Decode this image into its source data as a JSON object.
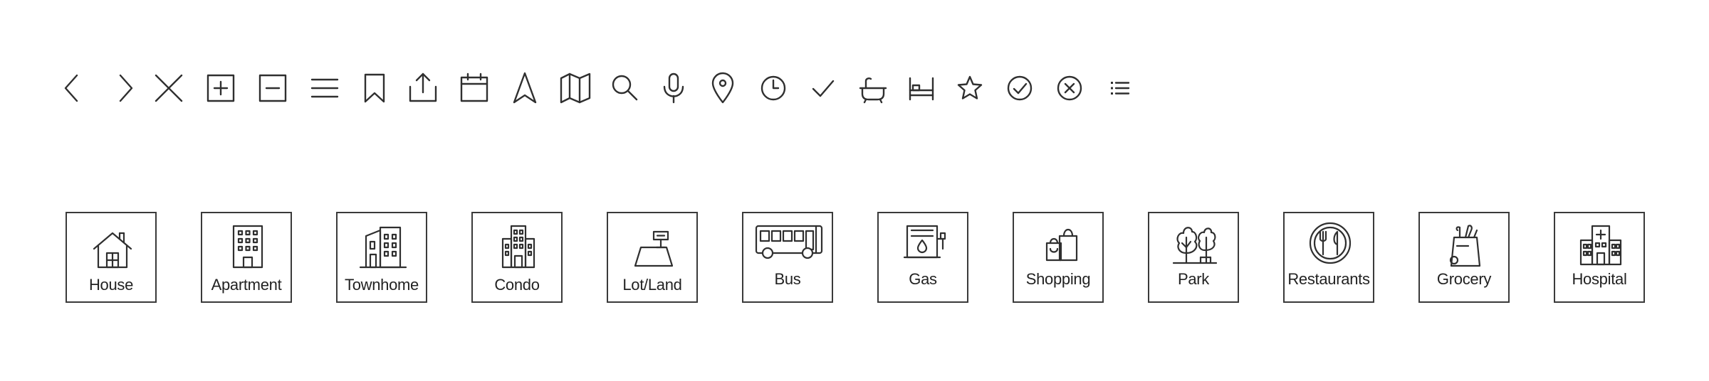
{
  "toolbar": {
    "icons": [
      "chevron-left-icon",
      "chevron-right-icon",
      "close-icon",
      "plus-square-icon",
      "minus-square-icon",
      "hamburger-menu-icon",
      "bookmark-icon",
      "share-upload-icon",
      "calendar-icon",
      "navigation-arrow-icon",
      "map-icon",
      "search-icon",
      "microphone-icon",
      "location-pin-icon",
      "clock-icon",
      "checkmark-icon",
      "bathtub-icon",
      "bed-icon",
      "star-icon",
      "check-circle-icon",
      "close-circle-icon",
      "list-icon"
    ]
  },
  "categories": [
    {
      "id": "house",
      "label": "House",
      "icon": "house-icon"
    },
    {
      "id": "apartment",
      "label": "Apartment",
      "icon": "apartment-icon"
    },
    {
      "id": "townhome",
      "label": "Townhome",
      "icon": "townhome-icon"
    },
    {
      "id": "condo",
      "label": "Condo",
      "icon": "condo-icon"
    },
    {
      "id": "lot-land",
      "label": "Lot/Land",
      "icon": "lot-land-icon"
    },
    {
      "id": "bus",
      "label": "Bus",
      "icon": "bus-icon"
    },
    {
      "id": "gas",
      "label": "Gas",
      "icon": "gas-pump-icon"
    },
    {
      "id": "shopping",
      "label": "Shopping",
      "icon": "shopping-bags-icon"
    },
    {
      "id": "park",
      "label": "Park",
      "icon": "park-trees-icon"
    },
    {
      "id": "restaurants",
      "label": "Restaurants",
      "icon": "plate-cutlery-icon"
    },
    {
      "id": "grocery",
      "label": "Grocery",
      "icon": "grocery-bag-icon"
    },
    {
      "id": "hospital",
      "label": "Hospital",
      "icon": "hospital-icon"
    }
  ]
}
